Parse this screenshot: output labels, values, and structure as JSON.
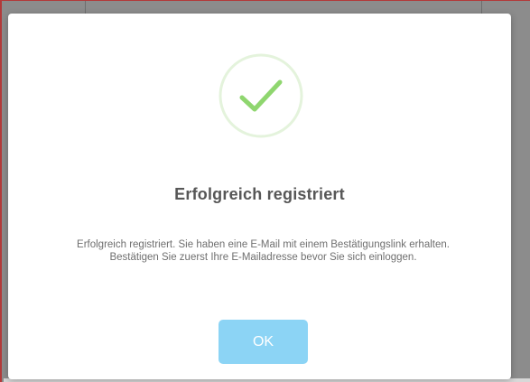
{
  "dialog": {
    "icon": "success-checkmark-icon",
    "title": "Erfolgreich registriert",
    "message": "Erfolgreich registriert. Sie haben eine E-Mail mit einem Bestätigungslink erhalten. Bestätigen Sie zuerst Ihre E-Mailadresse bevor Sie sich einloggen.",
    "ok_label": "OK"
  },
  "colors": {
    "success": "#8fd66f",
    "button": "#8cd4f5",
    "backdrop": "#8c8c8c"
  }
}
